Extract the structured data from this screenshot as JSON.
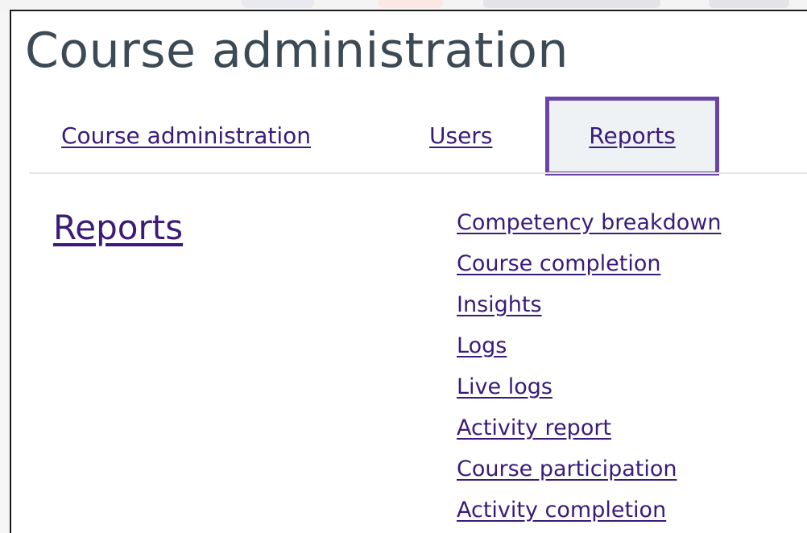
{
  "page": {
    "title": "Course administration"
  },
  "tabs": [
    {
      "label": "Course administration",
      "active": false
    },
    {
      "label": "Users",
      "active": false
    },
    {
      "label": "Reports",
      "active": true
    }
  ],
  "section": {
    "heading": "Reports",
    "links": [
      "Competency breakdown",
      "Course completion",
      "Insights",
      "Logs",
      "Live logs",
      "Activity report",
      "Course participation",
      "Activity completion"
    ]
  },
  "colors": {
    "link": "#3a1b7a",
    "title": "#3c4a56",
    "active_tab_border": "#6a44a9",
    "active_tab_bg": "#eef2f5"
  }
}
